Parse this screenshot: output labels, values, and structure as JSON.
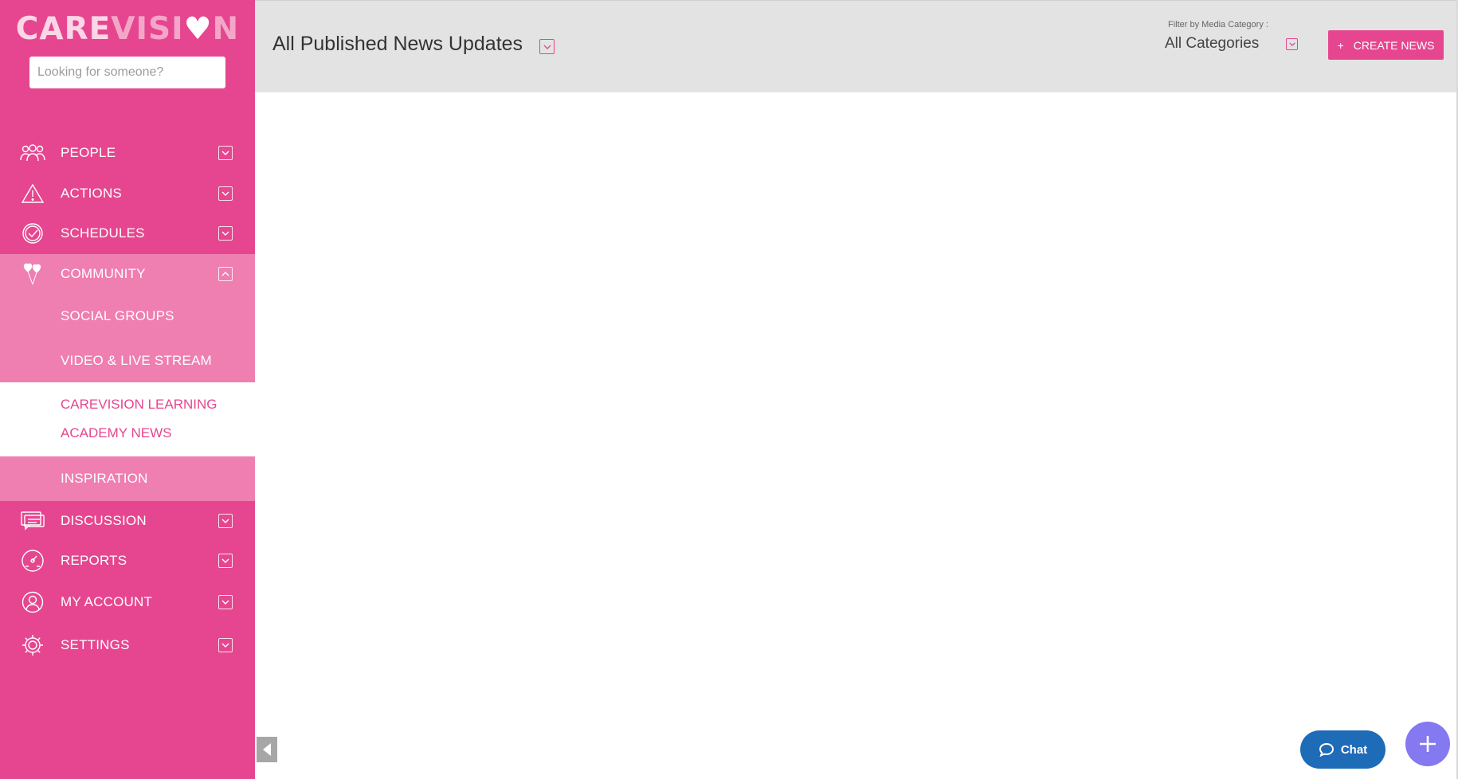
{
  "brand": {
    "logo_care": "CARE",
    "logo_vision_a": "VISI",
    "logo_heart": "♥",
    "logo_vision_b": "N",
    "accent": "#e6468f"
  },
  "search": {
    "placeholder": "Looking for someone?"
  },
  "sidebar": {
    "items": [
      {
        "label": "PEOPLE",
        "icon": "people-icon"
      },
      {
        "label": "ACTIONS",
        "icon": "warning-icon"
      },
      {
        "label": "SCHEDULES",
        "icon": "clock-check-icon"
      },
      {
        "label": "COMMUNITY",
        "icon": "hearts-balloon-icon"
      },
      {
        "label": "DISCUSSION",
        "icon": "chat-bubbles-icon"
      },
      {
        "label": "REPORTS",
        "icon": "gauge-icon"
      },
      {
        "label": "MY ACCOUNT",
        "icon": "user-circle-icon"
      },
      {
        "label": "SETTINGS",
        "icon": "gear-icon"
      }
    ],
    "community_sub": [
      {
        "label": "SOCIAL GROUPS"
      },
      {
        "label": "VIDEO & LIVE STREAM"
      },
      {
        "label_line1": "CAREVISION LEARNING",
        "label_line2": "ACADEMY NEWS",
        "active": true
      },
      {
        "label": "INSPIRATION"
      }
    ]
  },
  "header": {
    "title": "All Published News Updates",
    "filter_label": "Filter by Media Category :",
    "filter_value": "All Categories",
    "create_label": "CREATE NEWS",
    "create_plus": "+"
  },
  "chat": {
    "label": "Chat"
  }
}
